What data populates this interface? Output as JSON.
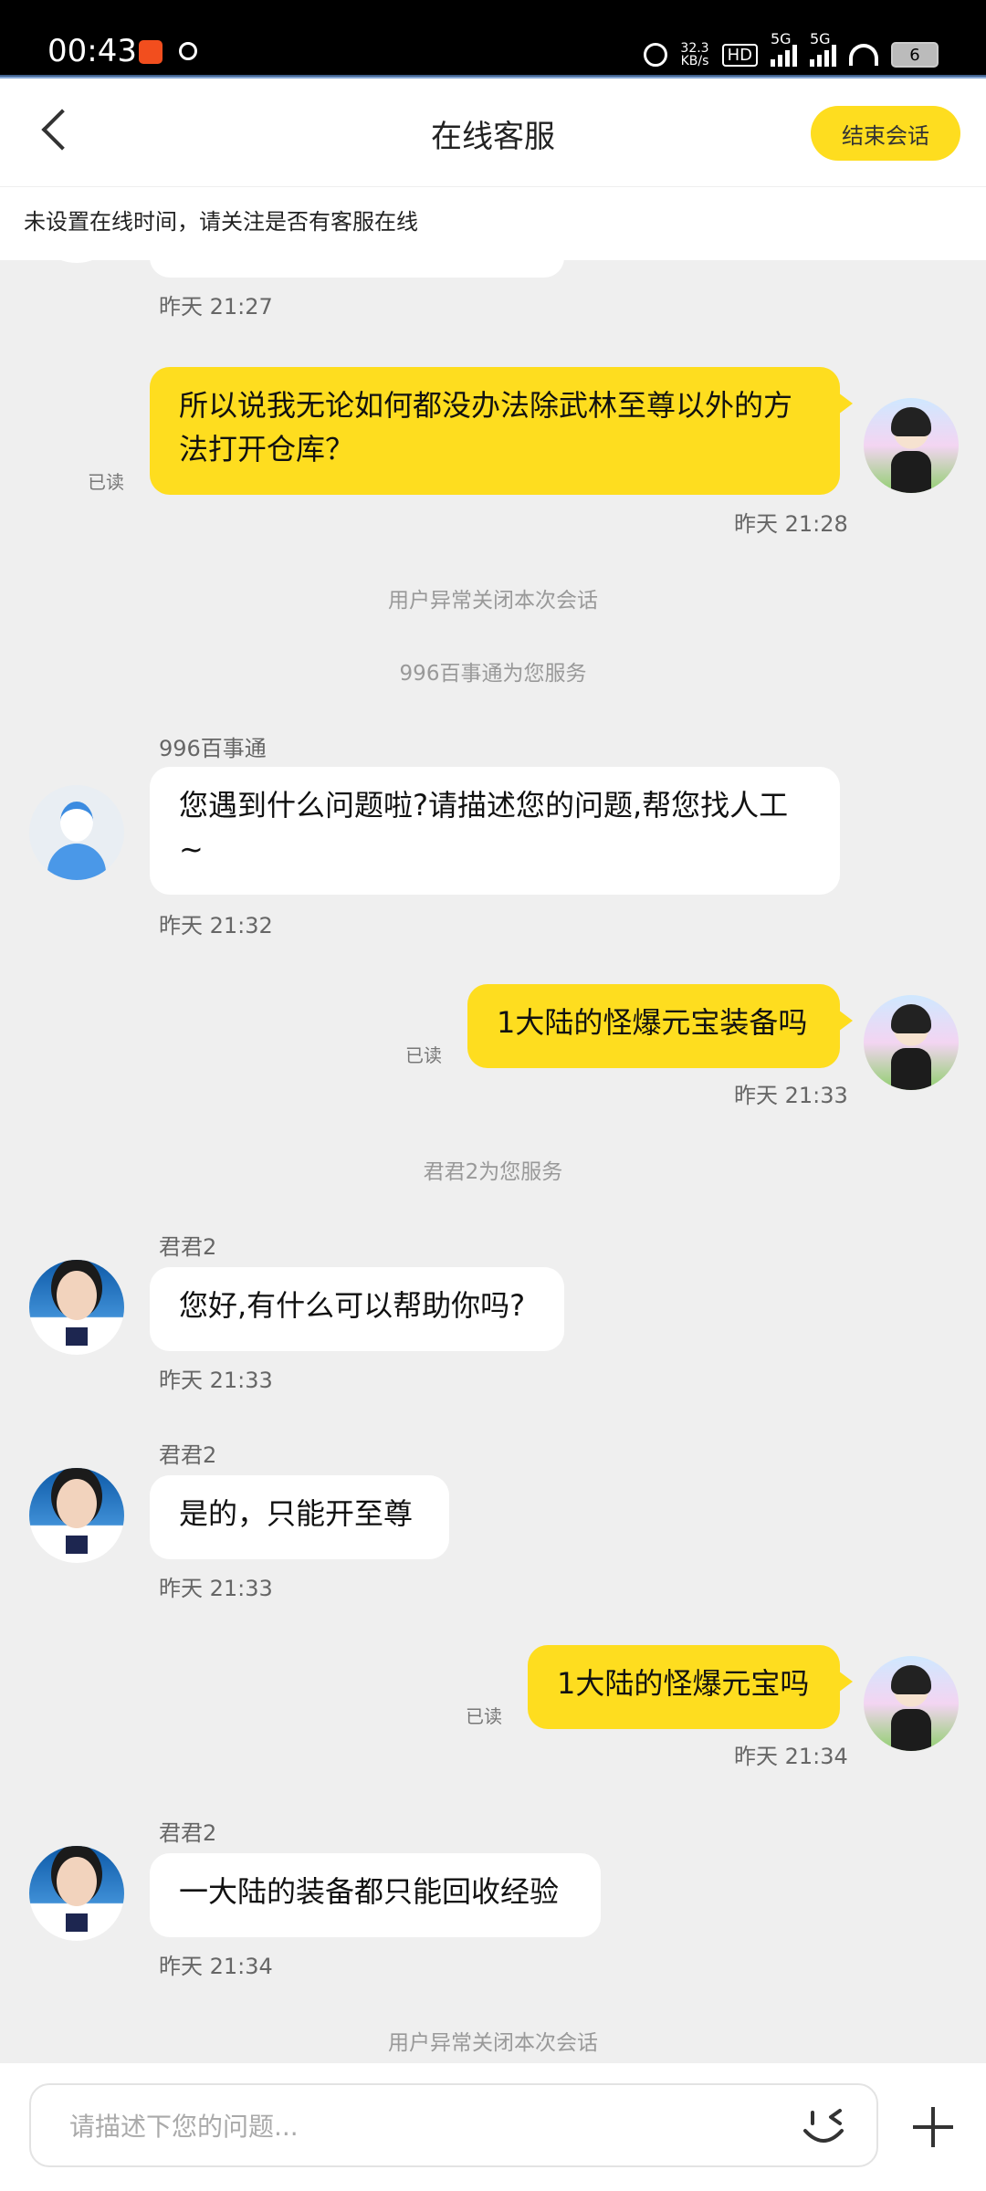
{
  "status_bar": {
    "time": "00:43",
    "net_speed_value": "32.3",
    "net_speed_unit": "KB/s",
    "hd_label": "HD",
    "sim1_label": "5G",
    "sim2_label": "5G",
    "battery": "6"
  },
  "header": {
    "title": "在线客服",
    "end_button": "结束会话"
  },
  "notice": "未设置在线时间，请关注是否有客服在线",
  "messages": {
    "m0_time": "昨天 21:27",
    "m1_text": "所以说我无论如何都没办法除武林至尊以外的方法打开仓库？",
    "m1_read": "已读",
    "m1_time": "昨天 21:28",
    "sys1": "用户异常关闭本次会话",
    "sys2": "996百事通为您服务",
    "m2_sender": "996百事通",
    "m2_text": "您遇到什么问题啦?请描述您的问题,帮您找人工~",
    "m2_time": "昨天 21:32",
    "m3_text": "1大陆的怪爆元宝装备吗",
    "m3_read": "已读",
    "m3_time": "昨天 21:33",
    "sys3": "君君2为您服务",
    "m4_sender": "君君2",
    "m4_text": "您好,有什么可以帮助你吗?",
    "m4_time": "昨天 21:33",
    "m5_sender": "君君2",
    "m5_text": "是的，只能开至尊",
    "m5_time": "昨天 21:33",
    "m6_text": "1大陆的怪爆元宝吗",
    "m6_read": "已读",
    "m6_time": "昨天 21:34",
    "m7_sender": "君君2",
    "m7_text": "一大陆的装备都只能回收经验",
    "m7_time": "昨天 21:34",
    "sys4": "用户异常关闭本次会话"
  },
  "input": {
    "placeholder": "请描述下您的问题..."
  }
}
